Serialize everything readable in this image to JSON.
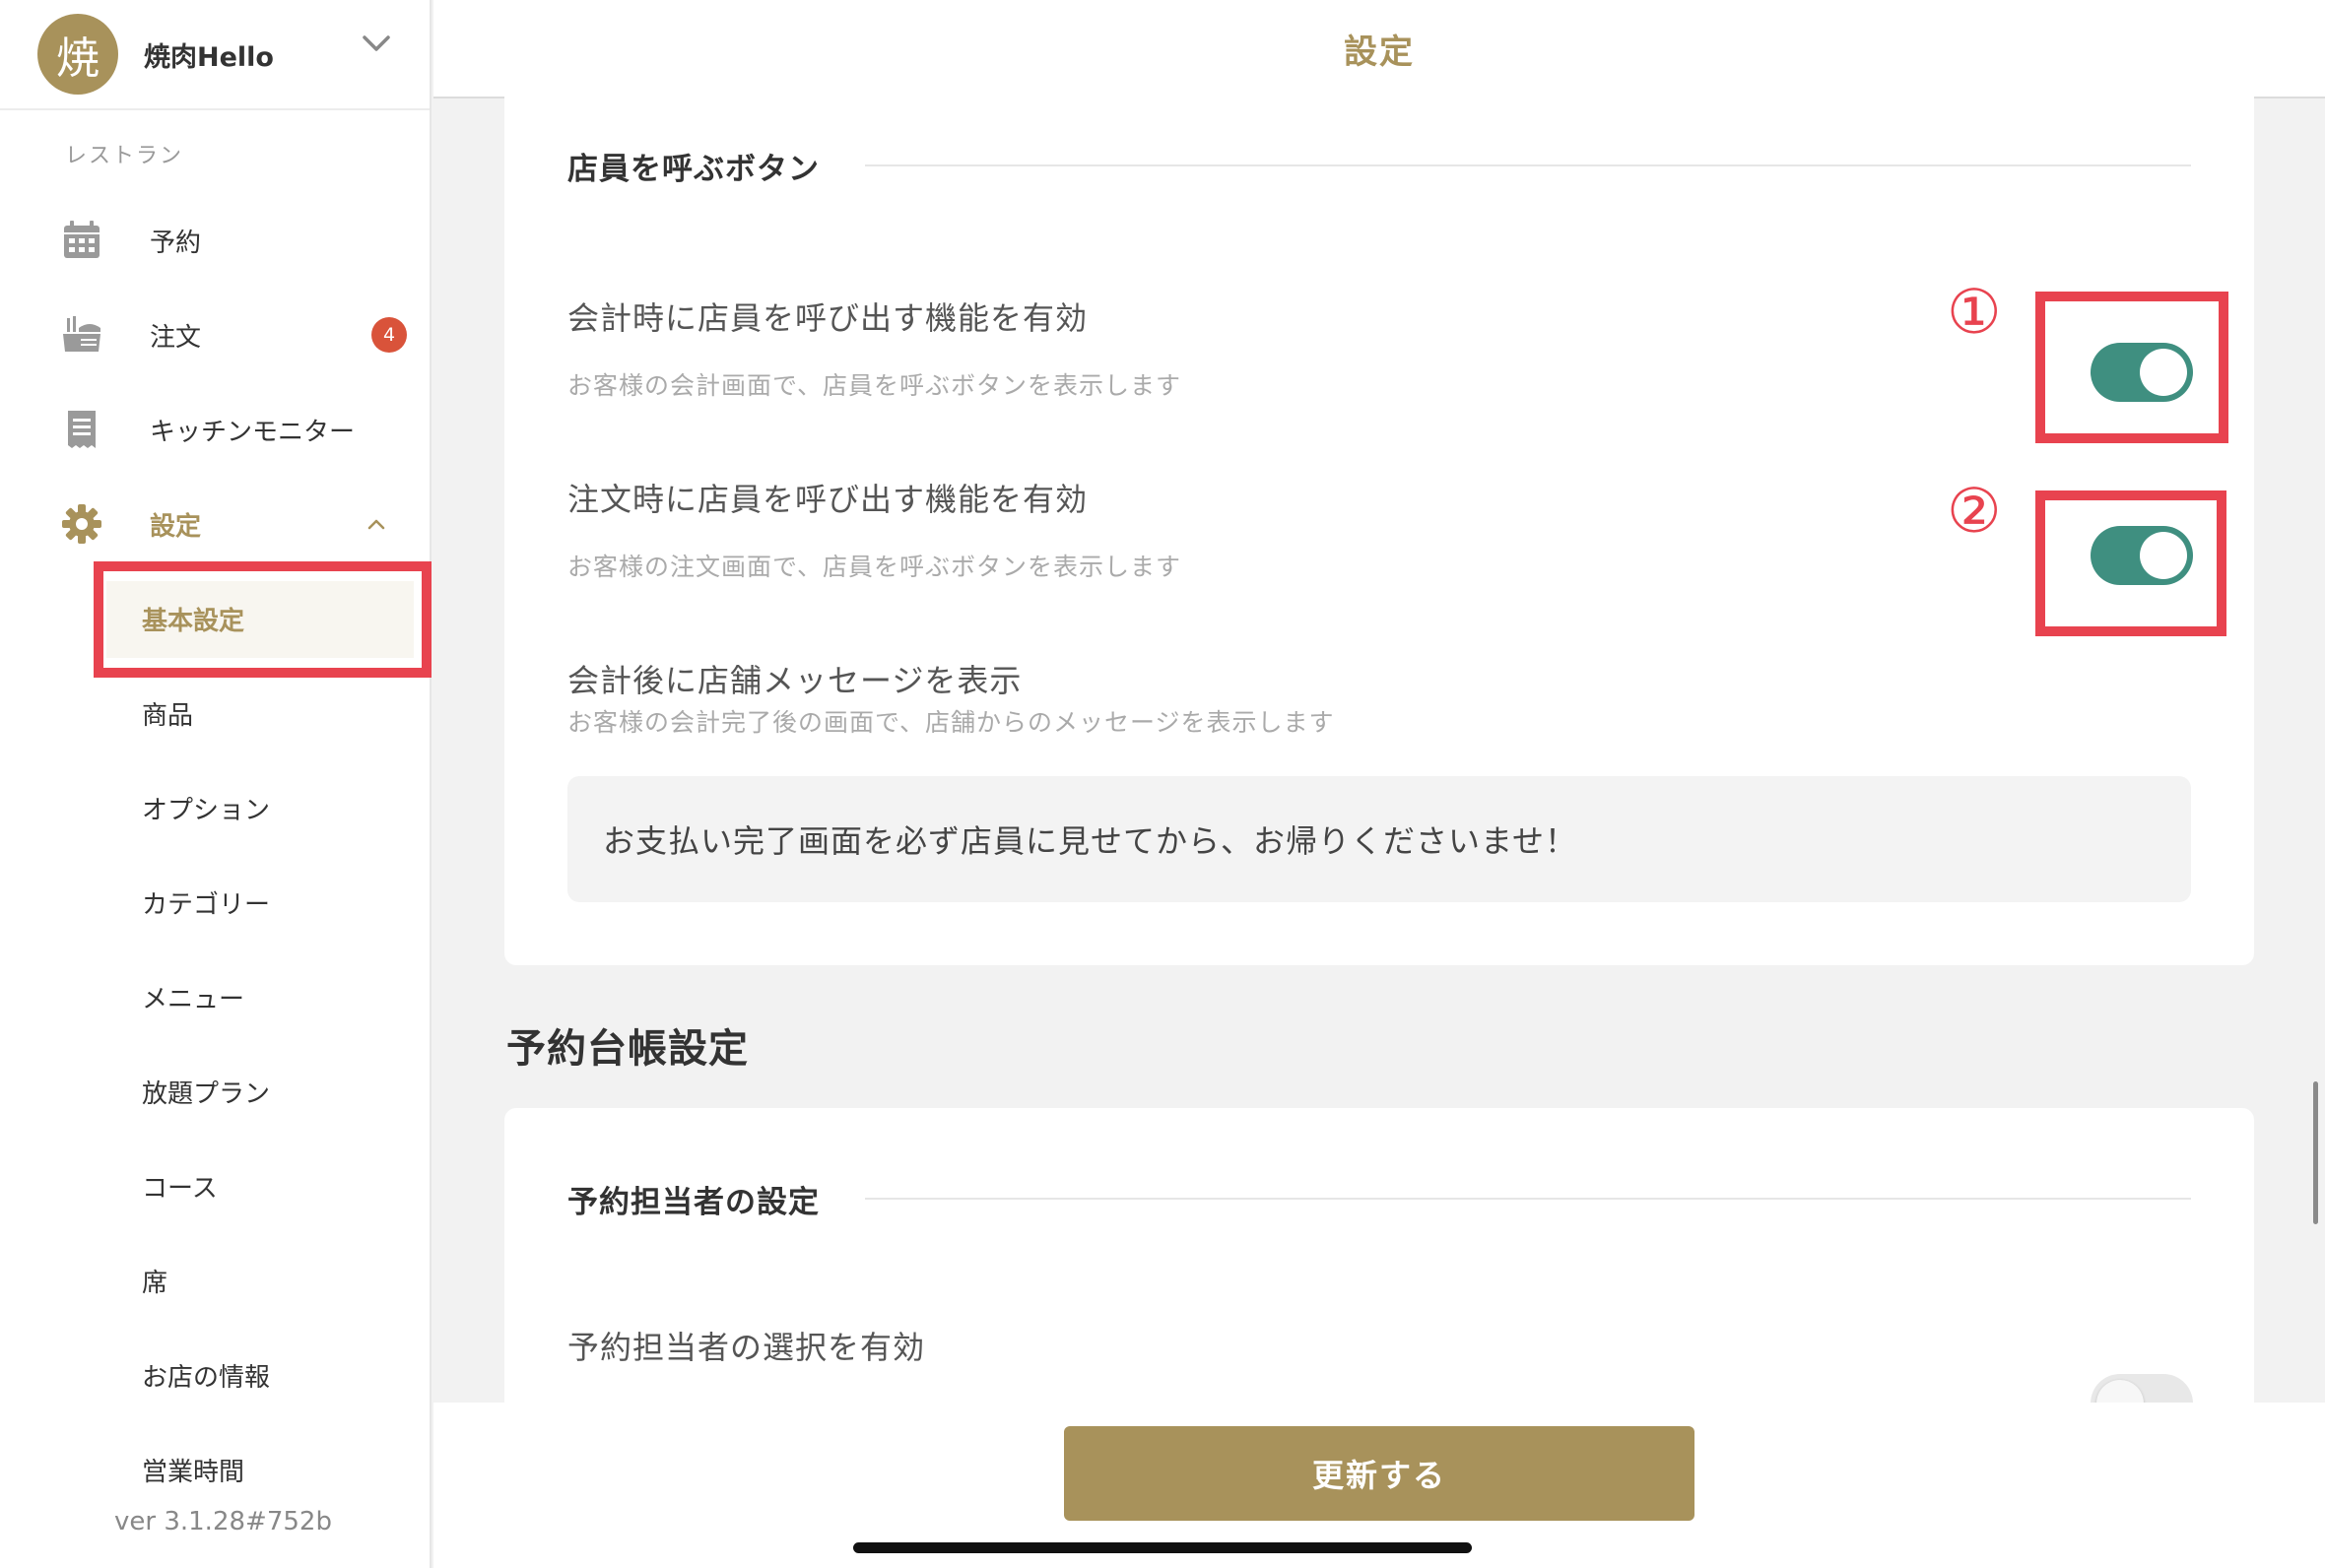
{
  "sidebar": {
    "store": {
      "avatar_char": "焼",
      "name": "焼肉Hello"
    },
    "section_label": "レストラン",
    "nav": [
      {
        "label": "予約",
        "icon": "calendar-icon"
      },
      {
        "label": "注文",
        "icon": "order-tray-icon",
        "badge": "4"
      },
      {
        "label": "キッチンモニター",
        "icon": "receipt-icon"
      },
      {
        "label": "設定",
        "icon": "gear-icon",
        "expanded": true
      }
    ],
    "sub_items": [
      {
        "label": "基本設定",
        "selected": true
      },
      {
        "label": "商品"
      },
      {
        "label": "オプション"
      },
      {
        "label": "カテゴリー"
      },
      {
        "label": "メニュー"
      },
      {
        "label": "放題プラン"
      },
      {
        "label": "コース"
      },
      {
        "label": "席"
      },
      {
        "label": "お店の情報"
      },
      {
        "label": "営業時間"
      }
    ],
    "version": "ver 3.1.28#752b"
  },
  "header": {
    "title": "設定"
  },
  "main": {
    "call_staff": {
      "heading": "店員を呼ぶボタン",
      "settings": [
        {
          "title": "会計時に店員を呼び出す機能を有効",
          "description": "お客様の会計画面で、店員を呼ぶボタンを表示します",
          "enabled": true,
          "annotation": "①"
        },
        {
          "title": "注文時に店員を呼び出す機能を有効",
          "description": "お客様の注文画面で、店員を呼ぶボタンを表示します",
          "enabled": true,
          "annotation": "②"
        }
      ],
      "message_setting": {
        "title": "会計後に店舗メッセージを表示",
        "description": "お客様の会計完了後の画面で、店舗からのメッセージを表示します",
        "value": "お支払い完了画面を必ず店員に見せてから、お帰りくださいませ！"
      }
    },
    "reservation_section": {
      "title": "予約台帳設定",
      "heading": "予約担当者の設定",
      "setting_title": "予約担当者の選択を有効",
      "enabled": false
    }
  },
  "footer": {
    "update_label": "更新する"
  },
  "colors": {
    "accent": "#a8925b",
    "toggle_on": "#3f8f80",
    "annotation": "#e8434f",
    "badge": "#d9533a"
  }
}
